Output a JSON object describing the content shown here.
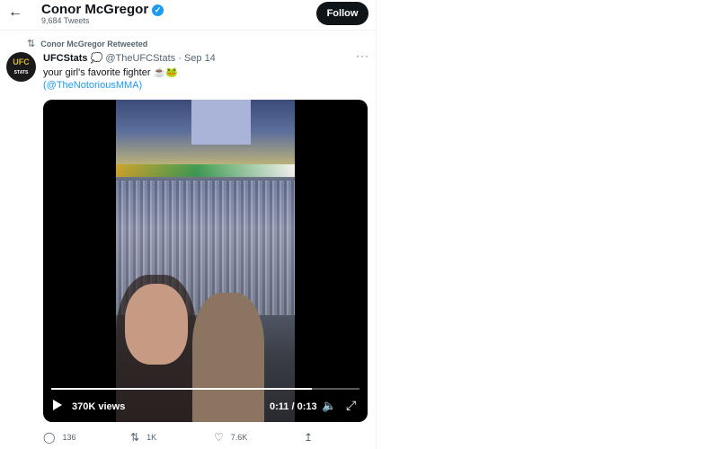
{
  "header": {
    "back_icon": "arrow-left-icon",
    "name": "Conor McGregor",
    "verified_icon": "verified-badge-icon",
    "tweets_count": "9,684 Tweets",
    "follow_label": "Follow"
  },
  "retweet": {
    "icon": "retweet-icon",
    "label": "Conor McGregor Retweeted"
  },
  "tweet": {
    "avatar_text": "UFC",
    "avatar_sub": "STATS",
    "display_name": "UFCStats",
    "handle": "@TheUFCStats",
    "separator": "·",
    "date": "Sep 14",
    "more_icon": "more-horizontal-icon",
    "text": "your girl's favorite fighter ☕🐸",
    "mention": "(@TheNotoriousMMA)"
  },
  "video": {
    "views": "370K views",
    "time": "0:11 / 0:13",
    "progress_fraction": 0.846,
    "play_icon": "play-icon",
    "volume_icon": "volume-icon",
    "fullscreen_icon": "fullscreen-icon"
  },
  "actions": {
    "reply_count": "136",
    "retweet_count": "1K",
    "like_count": "7.6K",
    "reply_icon": "reply-icon",
    "retweet_icon": "retweet-icon",
    "like_icon": "heart-icon",
    "share_icon": "share-icon"
  }
}
